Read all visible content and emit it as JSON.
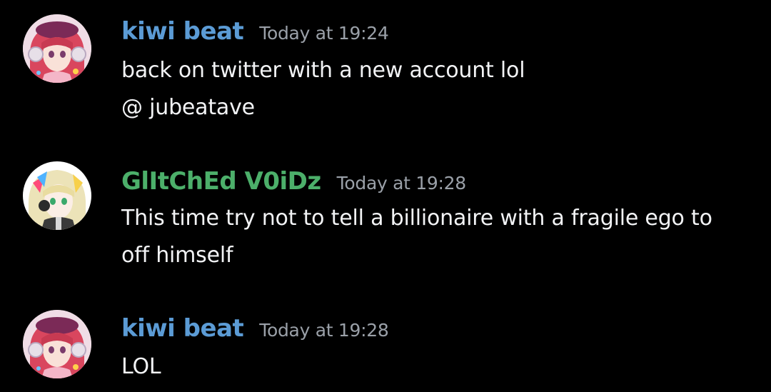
{
  "messages": [
    {
      "avatar_icon": "avatar-anime-girl-red-hair-headphones-icon",
      "username": "kiwi beat",
      "username_color": "#5b9bd5",
      "timestamp": "Today at 19:24",
      "lines": [
        "back on twitter with a new account lol",
        "@ jubeatave"
      ]
    },
    {
      "avatar_icon": "avatar-anime-girl-blonde-hair-icon",
      "username": "GlItChEd V0iDz",
      "username_color": "#4caf6a",
      "timestamp": "Today at 19:28",
      "lines": [
        "This time try not to tell a billionaire with a fragile ego to",
        "off himself"
      ]
    },
    {
      "avatar_icon": "avatar-anime-girl-red-hair-headphones-icon",
      "username": "kiwi beat",
      "username_color": "#5b9bd5",
      "timestamp": "Today at 19:28",
      "lines": [
        "LOL"
      ]
    }
  ]
}
